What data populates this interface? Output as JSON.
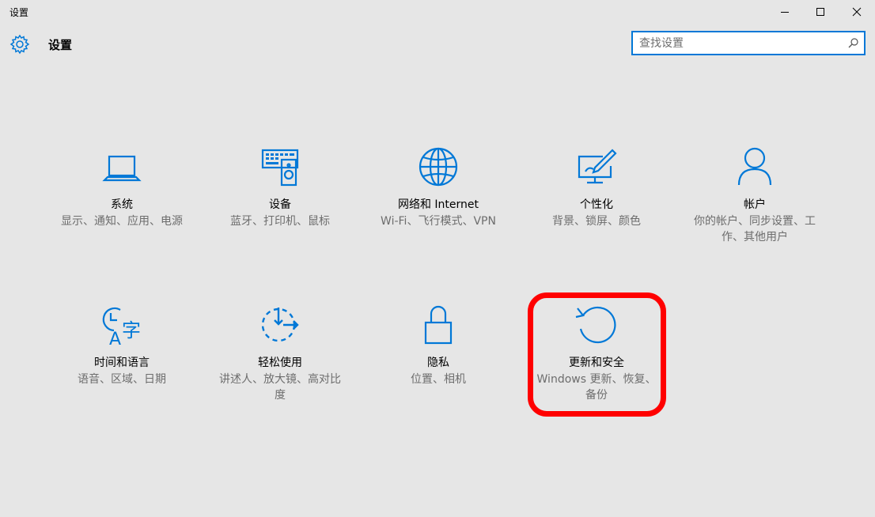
{
  "window": {
    "title": "设置",
    "controls": {
      "minimize": "minimize-icon",
      "maximize": "maximize-icon",
      "close": "close-icon"
    }
  },
  "header": {
    "title": "设置",
    "icon": "gear-icon"
  },
  "search": {
    "placeholder": "查找设置",
    "value": "",
    "icon": "search-icon"
  },
  "colors": {
    "accent": "#0078d7",
    "background": "#e6e6e6",
    "highlight": "#ff0000"
  },
  "tiles": [
    {
      "name": "系统",
      "desc": "显示、通知、应用、电源",
      "icon": "laptop-icon"
    },
    {
      "name": "设备",
      "desc": "蓝牙、打印机、鼠标",
      "icon": "devices-icon"
    },
    {
      "name": "网络和 Internet",
      "desc": "Wi-Fi、飞行模式、VPN",
      "icon": "globe-icon"
    },
    {
      "name": "个性化",
      "desc": "背景、锁屏、颜色",
      "icon": "personalization-icon"
    },
    {
      "name": "帐户",
      "desc": "你的帐户、同步设置、工作、其他用户",
      "icon": "person-icon"
    },
    {
      "name": "时间和语言",
      "desc": "语音、区域、日期",
      "icon": "time-language-icon"
    },
    {
      "name": "轻松使用",
      "desc": "讲述人、放大镜、高对比度",
      "icon": "ease-of-access-icon"
    },
    {
      "name": "隐私",
      "desc": "位置、相机",
      "icon": "lock-icon"
    },
    {
      "name": "更新和安全",
      "desc": "Windows 更新、恢复、备份",
      "icon": "update-icon"
    }
  ]
}
